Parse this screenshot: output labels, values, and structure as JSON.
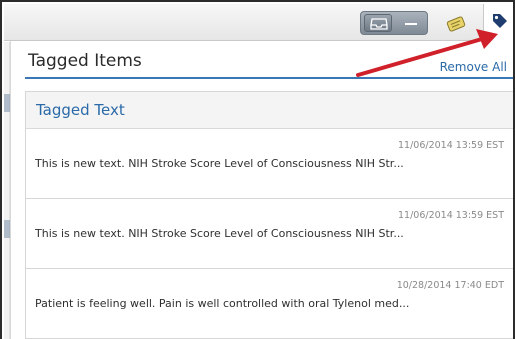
{
  "toolbar": {
    "icons": [
      "inbox-tray-icon",
      "minimize-icon",
      "notes-icon",
      "tag-icon"
    ]
  },
  "panel": {
    "title": "Tagged Items",
    "remove_all": "Remove All"
  },
  "section": {
    "title": "Tagged Text",
    "items": [
      {
        "timestamp": "11/06/2014 13:59 EST",
        "text": "This is new text. NIH Stroke Score Level of Consciousness NIH Str..."
      },
      {
        "timestamp": "11/06/2014 13:59 EST",
        "text": "This is new text. NIH Stroke Score Level of Consciousness NIH Str..."
      },
      {
        "timestamp": "10/28/2014 17:40 EDT",
        "text": "Patient is feeling well. Pain is well controlled with oral Tylenol med..."
      }
    ]
  },
  "colors": {
    "accent_blue": "#2a6aa8",
    "rule_blue": "#3a78b5",
    "annotation_red": "#d0202a",
    "tag_navy": "#1f3d6e"
  }
}
